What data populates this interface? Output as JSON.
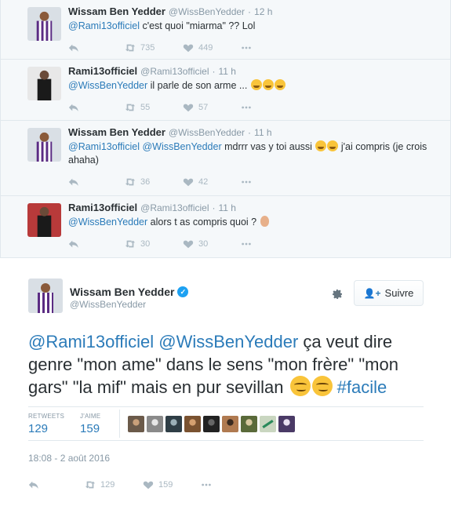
{
  "replies": [
    {
      "name": "Wissam Ben Yedder",
      "handle": "@WissBenYedder",
      "time": "12 h",
      "mention1": "@Rami13officiel",
      "mention2": "",
      "text": " c'est quoi \"miarma\" ?? Lol",
      "emojis": [],
      "retweets": "735",
      "likes": "449",
      "avatar_color": "#5b2c83"
    },
    {
      "name": "Rami13officiel",
      "handle": "@Rami13officiel",
      "time": "11 h",
      "mention1": "@WissBenYedder",
      "mention2": "",
      "text": " il parle de son arme ... ",
      "emojis": [
        "joy",
        "joy",
        "joy"
      ],
      "retweets": "55",
      "likes": "57",
      "avatar_color": "#1a1a1a"
    },
    {
      "name": "Wissam Ben Yedder",
      "handle": "@WissBenYedder",
      "time": "11 h",
      "mention1": "@Rami13officiel",
      "mention2": "@WissBenYedder",
      "text": " mdrrr vas y toi aussi ",
      "emojis": [
        "joy",
        "joy"
      ],
      "text2": " j'ai compris (je crois ahaha)",
      "retweets": "36",
      "likes": "42",
      "avatar_color": "#5b2c83"
    },
    {
      "name": "Rami13officiel",
      "handle": "@Rami13officiel",
      "time": "11 h",
      "mention1": "@WissBenYedder",
      "mention2": "",
      "text": " alors t as compris quoi ? ",
      "emojis": [
        "ear"
      ],
      "retweets": "30",
      "likes": "30",
      "avatar_color": "#1a1a1a"
    }
  ],
  "main": {
    "name": "Wissam Ben Yedder",
    "handle": "@WissBenYedder",
    "follow_label": "Suivre",
    "mention1": "@Rami13officiel",
    "mention2": "@WissBenYedder",
    "text": " ça veut dire genre \"mon ame\" dans le sens \"mon frère\" \"mon gars\" \"la mif\" mais en pur sevillan ",
    "hashtag": "#facile",
    "retweets_label": "RETWEETS",
    "retweets": "129",
    "likes_label": "J'AIME",
    "likes": "159",
    "date": "18:08 - 2 août 2016",
    "action_retweets": "129",
    "action_likes": "159",
    "accent": "#2b7bb9",
    "verified_color": "#1da1f2"
  },
  "likers_colors": [
    "#6b5a4a",
    "#8a8a8a",
    "#2f3e46",
    "#7a5230",
    "#222222",
    "#b07a50",
    "#5a6a3a",
    "#c9d6c0",
    "#4a3a66"
  ]
}
